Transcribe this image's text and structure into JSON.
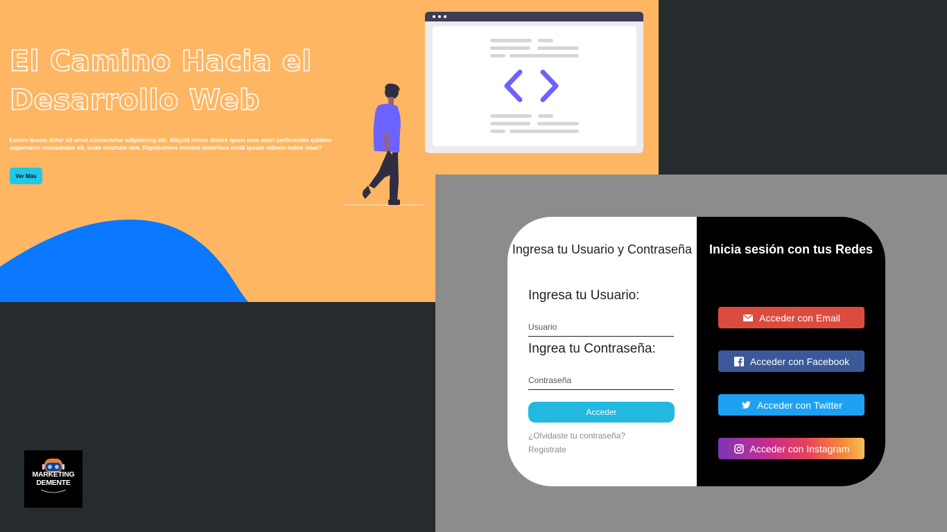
{
  "hero": {
    "title_line1": "El Camino Hacia el",
    "title_line2": "Desarrollo Web",
    "description": "Lorem ipsum dolor sit amet consectetur adipisicing elit. Aliquid rerum dolore quasi eum amet perferendis quidem aspernatur recusandae sit, iusto nostrum sint. Dignissimos minima doloribus modi ipsum ratione nobis vitae?",
    "button_label": "Ver Más",
    "colors": {
      "background": "#feb663",
      "wave": "#0a78ff",
      "button": "#1fc8e8",
      "code_icon": "#6c63ff",
      "person_shirt": "#6c63ff"
    }
  },
  "logo": {
    "line1": "MARKETING",
    "line2": "DEMENTE"
  },
  "login": {
    "title": "Ingresa tu Usuario y Contraseña",
    "username_label": "Ingresa tu Usuario:",
    "username_placeholder": "Usuario",
    "password_label": "Ingrea tu Contraseña:",
    "password_placeholder": "Contraseña",
    "submit_label": "Acceder",
    "forgot_link": "¿Olvidaste tu contraseña?",
    "register_link": "Registrate"
  },
  "social": {
    "title": "Inicia sesión con tus Redes",
    "buttons": [
      {
        "label": "Acceder con Email",
        "icon": "envelope-icon",
        "color": "#dc4c3e"
      },
      {
        "label": "Acceder con Facebook",
        "icon": "facebook-icon",
        "color": "#3b5998"
      },
      {
        "label": "Acceder con Twitter",
        "icon": "twitter-icon",
        "color": "#1ea1f2"
      },
      {
        "label": "Acceder con Instagram",
        "icon": "instagram-icon",
        "color": "#c52f8d"
      }
    ]
  }
}
